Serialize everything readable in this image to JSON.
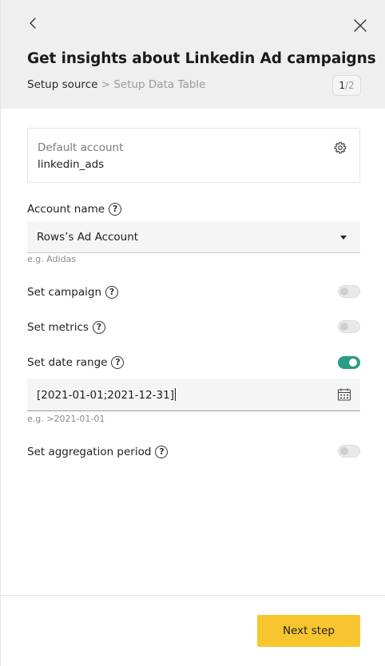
{
  "header": {
    "title": "Get insights about Linkedin Ad campaigns",
    "breadcrumb": {
      "current": "Setup source",
      "separator": ">",
      "next": "Setup Data Table"
    },
    "step": {
      "current": "1",
      "separator": "/",
      "total": "2"
    }
  },
  "account": {
    "label": "Default account",
    "value": "linkedin_ads"
  },
  "fields": {
    "account_name": {
      "label": "Account name",
      "value": "Rows’s Ad Account",
      "hint": "e.g. Adidas"
    },
    "campaign": {
      "label": "Set campaign",
      "enabled": false
    },
    "metrics": {
      "label": "Set metrics",
      "enabled": false
    },
    "date_range": {
      "label": "Set date range",
      "enabled": true,
      "value": "[2021-01-01;2021-12-31]",
      "hint": "e.g. >2021-01-01"
    },
    "aggregation_period": {
      "label": "Set aggregation period",
      "enabled": false
    }
  },
  "help_symbol": "?",
  "footer": {
    "next_label": "Next step"
  },
  "colors": {
    "accent_button": "#f7c52f",
    "toggle_on": "#2a9d82",
    "header_bg": "#efefef"
  },
  "icons": [
    "chevron-left-icon",
    "close-icon",
    "gear-icon",
    "help-icon",
    "calendar-icon",
    "dropdown-caret-icon"
  ]
}
